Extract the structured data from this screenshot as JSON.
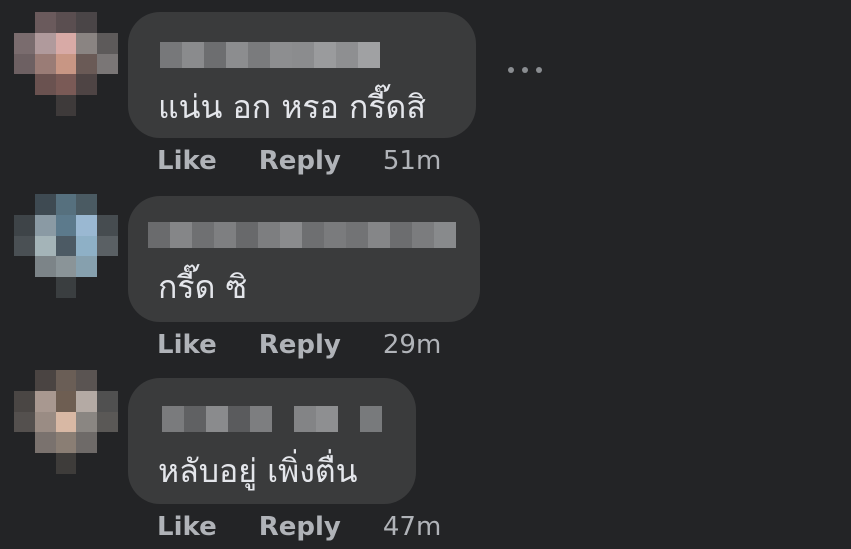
{
  "comments": [
    {
      "text": "แน่น อก หรอ กรี๊ดสิ",
      "like_label": "Like",
      "reply_label": "Reply",
      "time": "51m"
    },
    {
      "text": "กรี๊ด ซิ",
      "like_label": "Like",
      "reply_label": "Reply",
      "time": "29m"
    },
    {
      "text": "หลับอยู่ เพิ่งตื่น",
      "like_label": "Like",
      "reply_label": "Reply",
      "time": "47m"
    }
  ],
  "more_icon": "more-options-icon",
  "colors": {
    "background": "#232426",
    "bubble": "#3a3b3c",
    "text": "#e4e6eb",
    "secondary": "#b0b3b8"
  }
}
